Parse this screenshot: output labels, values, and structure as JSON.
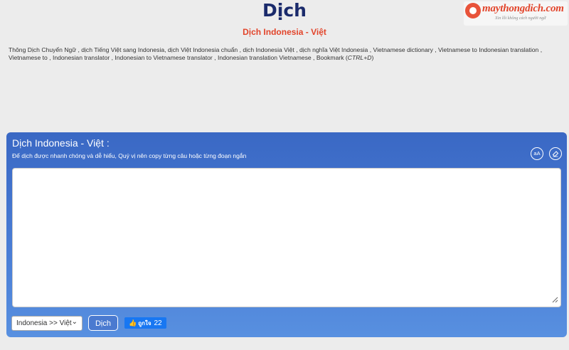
{
  "header": {
    "title": "Dịch",
    "subtitle": "Dịch Indonesia - Việt"
  },
  "logo": {
    "text": "maythongdich.com",
    "tagline": "Xin lỗi không cách người ngữ"
  },
  "keywords": {
    "text": "Thông Dịch Chuyển Ngữ , dịch Tiếng Việt sang Indonesia, dịch Việt Indonesia chuẩn , dịch Indonesia Việt , dịch nghĩa Việt Indonesia , Vietnamese dictionary , Vietnamese to Indonesian translation , Vietnamese to , Indonesian translator , Indonesian to Vietnamese translator , Indonesian translation Vietnamese , Bookmark (",
    "shortcut": "CTRL+D",
    "suffix": ")"
  },
  "panel": {
    "title": "Dịch Indonesia - Việt :",
    "hint": "Để dịch được nhanh chóng và dễ hiểu, Quý vị nên copy từng câu hoặc từng đoạn ngắn",
    "font_icon": "aA",
    "erase_icon": "eraser-icon",
    "input_value": "",
    "language_selected": "Indonesia >> Việt",
    "translate_label": "Dịch",
    "like_label": "ถูกใจ",
    "like_count": "22"
  },
  "colors": {
    "panel": "#3a68c4",
    "title": "#1a2a6b",
    "accent": "#e2442a",
    "facebook": "#1877f2"
  }
}
